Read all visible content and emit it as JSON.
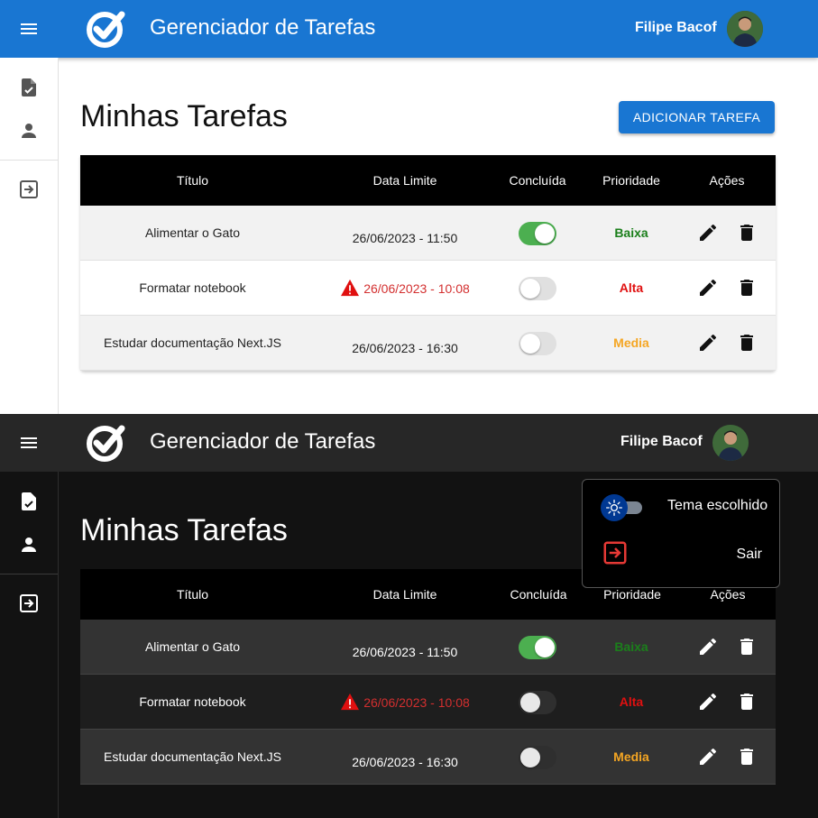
{
  "app": {
    "title": "Gerenciador de Tarefas",
    "user_name": "Filipe Bacof"
  },
  "page": {
    "title": "Minhas Tarefas",
    "add_button": "ADICIONAR TAREFA"
  },
  "table": {
    "columns": [
      "Título",
      "Data Limite",
      "Concluída",
      "Prioridade",
      "Ações"
    ],
    "rows": [
      {
        "title": "Alimentar o Gato",
        "deadline": "26/06/2023 - 11:50",
        "overdue": false,
        "done": true,
        "priority": "Baixa"
      },
      {
        "title": "Formatar notebook",
        "deadline": "26/06/2023 - 10:08",
        "overdue": true,
        "done": false,
        "priority": "Alta"
      },
      {
        "title": "Estudar documentação Next.JS",
        "deadline": "26/06/2023 - 16:30",
        "overdue": false,
        "done": false,
        "priority": "Media"
      }
    ]
  },
  "user_menu": {
    "theme_label": "Tema escolhido",
    "logout_label": "Sair"
  },
  "colors": {
    "primary": "#1976d2",
    "dark_appbar": "#272727",
    "dark_bg": "#121212",
    "priority_low": "#1b7f1b",
    "priority_high": "#e01010",
    "priority_medium": "#f5a623",
    "switch_on": "#4caf50",
    "overdue": "#d32f2f"
  },
  "icons": [
    "menu-icon",
    "task-check-logo",
    "avatar",
    "task-document-icon",
    "person-icon",
    "logout-icon",
    "warning-icon",
    "edit-icon",
    "delete-icon",
    "sun-icon"
  ]
}
